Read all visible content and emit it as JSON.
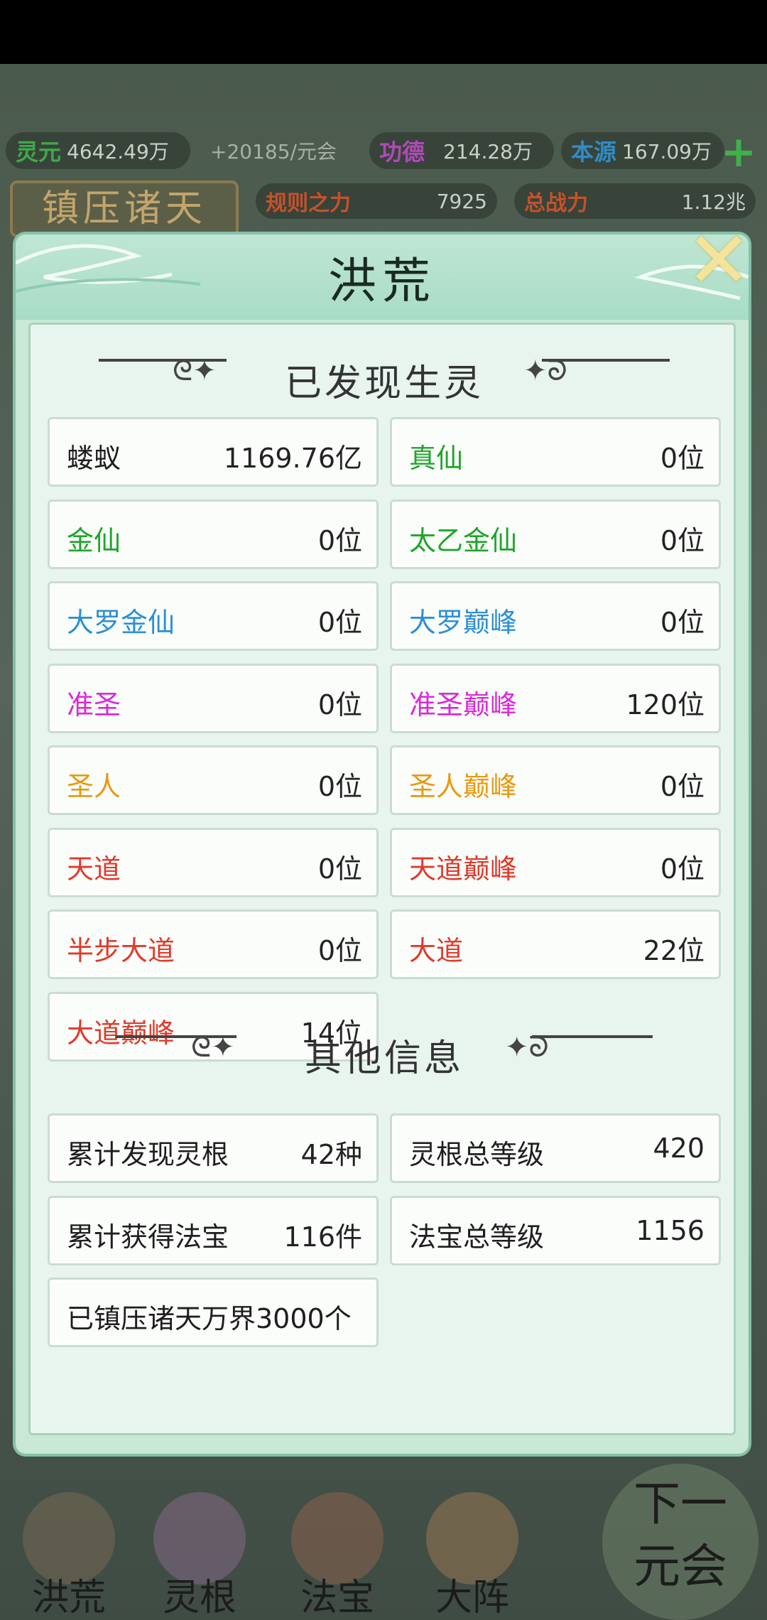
{
  "top_bar": {
    "spirit_label": "灵元",
    "spirit_value": "4642.49万",
    "spirit_rate": "+20185/元会",
    "merit_label": "功德",
    "merit_value": "214.28万",
    "origin_label": "本源",
    "origin_value": "167.09万",
    "rule_label": "规则之力",
    "rule_value": "7925",
    "power_label": "总战力",
    "power_value": "1.12兆",
    "suppress_button": "镇压诸天"
  },
  "panel": {
    "title": "洪荒",
    "section1_title": "已发现生灵",
    "creatures": [
      {
        "label": "蝼蚁",
        "value": "1169.76亿",
        "color": "#1e1e1e"
      },
      {
        "label": "真仙",
        "value": "0位",
        "color": "#1fa52b"
      },
      {
        "label": "金仙",
        "value": "0位",
        "color": "#1fa52b"
      },
      {
        "label": "太乙金仙",
        "value": "0位",
        "color": "#1fa52b"
      },
      {
        "label": "大罗金仙",
        "value": "0位",
        "color": "#2d8fd6"
      },
      {
        "label": "大罗巅峰",
        "value": "0位",
        "color": "#2d8fd6"
      },
      {
        "label": "准圣",
        "value": "0位",
        "color": "#d92ad6"
      },
      {
        "label": "准圣巅峰",
        "value": "120位",
        "color": "#d92ad6"
      },
      {
        "label": "圣人",
        "value": "0位",
        "color": "#e89a12"
      },
      {
        "label": "圣人巅峰",
        "value": "0位",
        "color": "#e89a12"
      },
      {
        "label": "天道",
        "value": "0位",
        "color": "#e03a2a"
      },
      {
        "label": "天道巅峰",
        "value": "0位",
        "color": "#e03a2a"
      },
      {
        "label": "半步大道",
        "value": "0位",
        "color": "#e03a2a"
      },
      {
        "label": "大道",
        "value": "22位",
        "color": "#e03a2a"
      },
      {
        "label": "大道巅峰",
        "value": "14位",
        "color": "#e03a2a"
      }
    ],
    "section2_title": "其他信息",
    "info": [
      {
        "label": "累计发现灵根",
        "value": "42种"
      },
      {
        "label": "灵根总等级",
        "value": "420"
      },
      {
        "label": "累计获得法宝",
        "value": "116件"
      },
      {
        "label": "法宝总等级",
        "value": "1156"
      },
      {
        "label": "已镇压诸天万界3000个",
        "value": ""
      }
    ]
  },
  "bottom_nav": {
    "items": [
      "洪荒",
      "灵根",
      "法宝",
      "大阵"
    ],
    "next_line1": "下一",
    "next_line2": "元会"
  }
}
